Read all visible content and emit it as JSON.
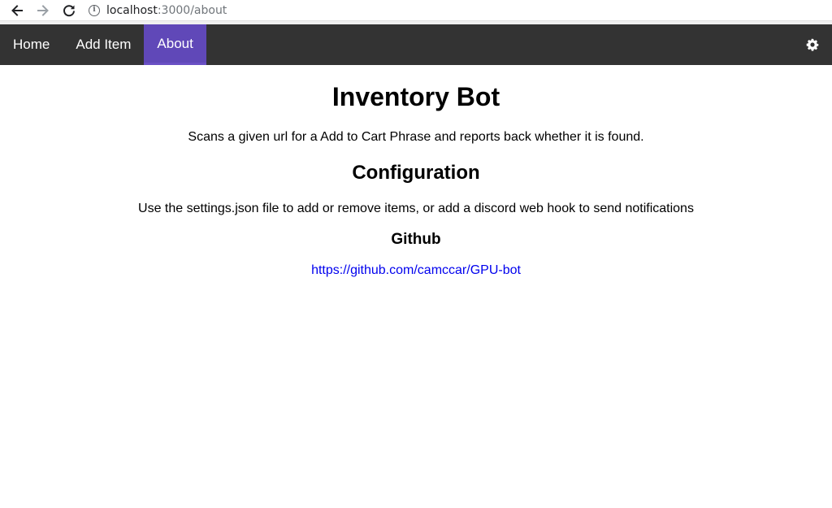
{
  "browser": {
    "url_host": "localhost",
    "url_path": ":3000/about"
  },
  "navbar": {
    "items": [
      {
        "label": "Home",
        "active": false
      },
      {
        "label": "Add Item",
        "active": false
      },
      {
        "label": "About",
        "active": true
      }
    ],
    "settings_icon": "gear-icon",
    "background_color": "#333333",
    "active_color": "#6048b8"
  },
  "main": {
    "title": "Inventory Bot",
    "description": "Scans a given url for a Add to Cart Phrase and reports back whether it is found.",
    "config_heading": "Configuration",
    "config_text": "Use the settings.json file to add or remove items, or add a discord web hook to send notifications",
    "github_heading": "Github",
    "github_link": "https://github.com/camccar/GPU-bot",
    "link_color": "#0000ee"
  }
}
